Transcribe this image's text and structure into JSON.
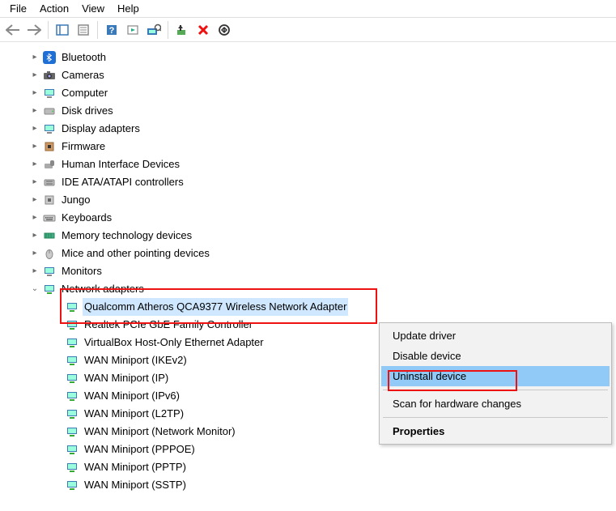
{
  "menu": {
    "file": "File",
    "action": "Action",
    "view": "View",
    "help": "Help"
  },
  "tree": {
    "bluetooth": "Bluetooth",
    "cameras": "Cameras",
    "computer": "Computer",
    "diskdrives": "Disk drives",
    "displayadapters": "Display adapters",
    "firmware": "Firmware",
    "hid": "Human Interface Devices",
    "ide": "IDE ATA/ATAPI controllers",
    "jungo": "Jungo",
    "keyboards": "Keyboards",
    "memtech": "Memory technology devices",
    "mice": "Mice and other pointing devices",
    "monitors": "Monitors",
    "netadapters": "Network adapters",
    "net_items": [
      "Qualcomm Atheros QCA9377 Wireless Network Adapter",
      "Realtek PCIe GbE Family Controller",
      "VirtualBox Host-Only Ethernet Adapter",
      "WAN Miniport (IKEv2)",
      "WAN Miniport (IP)",
      "WAN Miniport (IPv6)",
      "WAN Miniport (L2TP)",
      "WAN Miniport (Network Monitor)",
      "WAN Miniport (PPPOE)",
      "WAN Miniport (PPTP)",
      "WAN Miniport (SSTP)"
    ]
  },
  "context_menu": {
    "update": "Update driver",
    "disable": "Disable device",
    "uninstall": "Uninstall device",
    "scan": "Scan for hardware changes",
    "properties": "Properties"
  }
}
